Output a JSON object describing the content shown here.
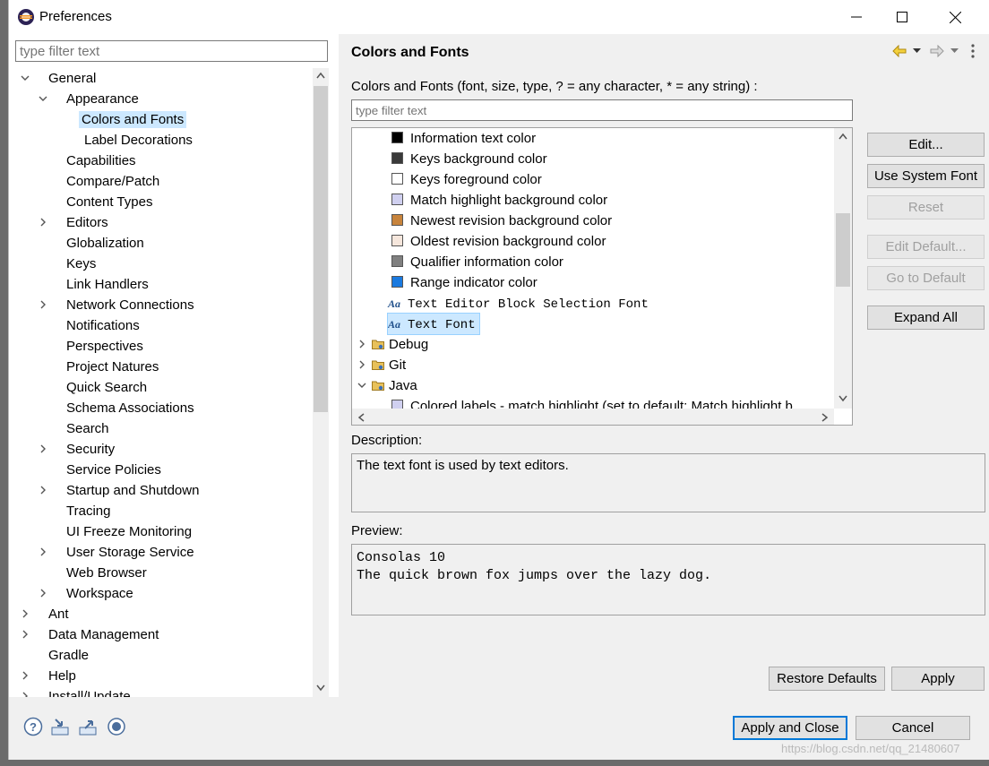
{
  "window": {
    "title": "Preferences"
  },
  "left": {
    "filter_placeholder": "type filter text",
    "tree": [
      {
        "label": "General",
        "level": 0,
        "expander": "open"
      },
      {
        "label": "Appearance",
        "level": 1,
        "expander": "open"
      },
      {
        "label": "Colors and Fonts",
        "level": 2,
        "expander": "none",
        "selected": true
      },
      {
        "label": "Label Decorations",
        "level": 2,
        "expander": "none"
      },
      {
        "label": "Capabilities",
        "level": 1,
        "expander": "none"
      },
      {
        "label": "Compare/Patch",
        "level": 1,
        "expander": "none"
      },
      {
        "label": "Content Types",
        "level": 1,
        "expander": "none"
      },
      {
        "label": "Editors",
        "level": 1,
        "expander": "closed"
      },
      {
        "label": "Globalization",
        "level": 1,
        "expander": "none"
      },
      {
        "label": "Keys",
        "level": 1,
        "expander": "none"
      },
      {
        "label": "Link Handlers",
        "level": 1,
        "expander": "none"
      },
      {
        "label": "Network Connections",
        "level": 1,
        "expander": "closed"
      },
      {
        "label": "Notifications",
        "level": 1,
        "expander": "none"
      },
      {
        "label": "Perspectives",
        "level": 1,
        "expander": "none"
      },
      {
        "label": "Project Natures",
        "level": 1,
        "expander": "none"
      },
      {
        "label": "Quick Search",
        "level": 1,
        "expander": "none"
      },
      {
        "label": "Schema Associations",
        "level": 1,
        "expander": "none"
      },
      {
        "label": "Search",
        "level": 1,
        "expander": "none"
      },
      {
        "label": "Security",
        "level": 1,
        "expander": "closed"
      },
      {
        "label": "Service Policies",
        "level": 1,
        "expander": "none"
      },
      {
        "label": "Startup and Shutdown",
        "level": 1,
        "expander": "closed"
      },
      {
        "label": "Tracing",
        "level": 1,
        "expander": "none"
      },
      {
        "label": "UI Freeze Monitoring",
        "level": 1,
        "expander": "none"
      },
      {
        "label": "User Storage Service",
        "level": 1,
        "expander": "closed"
      },
      {
        "label": "Web Browser",
        "level": 1,
        "expander": "none"
      },
      {
        "label": "Workspace",
        "level": 1,
        "expander": "closed"
      },
      {
        "label": "Ant",
        "level": 0,
        "expander": "closed"
      },
      {
        "label": "Data Management",
        "level": 0,
        "expander": "closed"
      },
      {
        "label": "Gradle",
        "level": 0,
        "expander": "none"
      },
      {
        "label": "Help",
        "level": 0,
        "expander": "closed"
      },
      {
        "label": "Install/Update",
        "level": 0,
        "expander": "closed"
      }
    ]
  },
  "right": {
    "title": "Colors and Fonts",
    "filter_label": "Colors and Fonts (font, size, type, ? = any character, * = any string) :",
    "filter_placeholder": "type filter text",
    "items": [
      {
        "label": "Information text color",
        "kind": "color",
        "color": "#000000"
      },
      {
        "label": "Keys background color",
        "kind": "color",
        "color": "#3a3a3a"
      },
      {
        "label": "Keys foreground color",
        "kind": "color",
        "color": "#ffffff"
      },
      {
        "label": "Match highlight background color",
        "kind": "color",
        "color": "#d0d0f0"
      },
      {
        "label": "Newest revision background color",
        "kind": "color",
        "color": "#c8843c"
      },
      {
        "label": "Oldest revision background color",
        "kind": "color",
        "color": "#f5e6dc"
      },
      {
        "label": "Qualifier information color",
        "kind": "color",
        "color": "#808080"
      },
      {
        "label": "Range indicator color",
        "kind": "color",
        "color": "#1a7ae0"
      },
      {
        "label": "Text Editor Block Selection Font",
        "kind": "font"
      },
      {
        "label": "Text Font",
        "kind": "font",
        "selected": true
      },
      {
        "label": "Debug",
        "kind": "category",
        "expander": "closed"
      },
      {
        "label": "Git",
        "kind": "category",
        "expander": "closed"
      },
      {
        "label": "Java",
        "kind": "category",
        "expander": "open"
      },
      {
        "label": "Colored labels - match highlight (set to default: Match highlight b",
        "kind": "color",
        "color": "#d0d0f0"
      }
    ],
    "buttons": {
      "edit": "Edit...",
      "use_system_font": "Use System Font",
      "reset": "Reset",
      "edit_default": "Edit Default...",
      "go_to_default": "Go to Default",
      "expand_all": "Expand All",
      "restore_defaults": "Restore Defaults",
      "apply": "Apply"
    },
    "description_label": "Description:",
    "description_text": "The text font is used by text editors.",
    "preview_label": "Preview:",
    "preview_lines": [
      "Consolas 10",
      "The quick brown fox jumps over the lazy dog."
    ]
  },
  "footer": {
    "apply_and_close": "Apply and Close",
    "cancel": "Cancel",
    "watermark": "https://blog.csdn.net/qq_21480607"
  },
  "colors": {
    "selection": "#cce8ff",
    "accent": "#0078d7"
  }
}
